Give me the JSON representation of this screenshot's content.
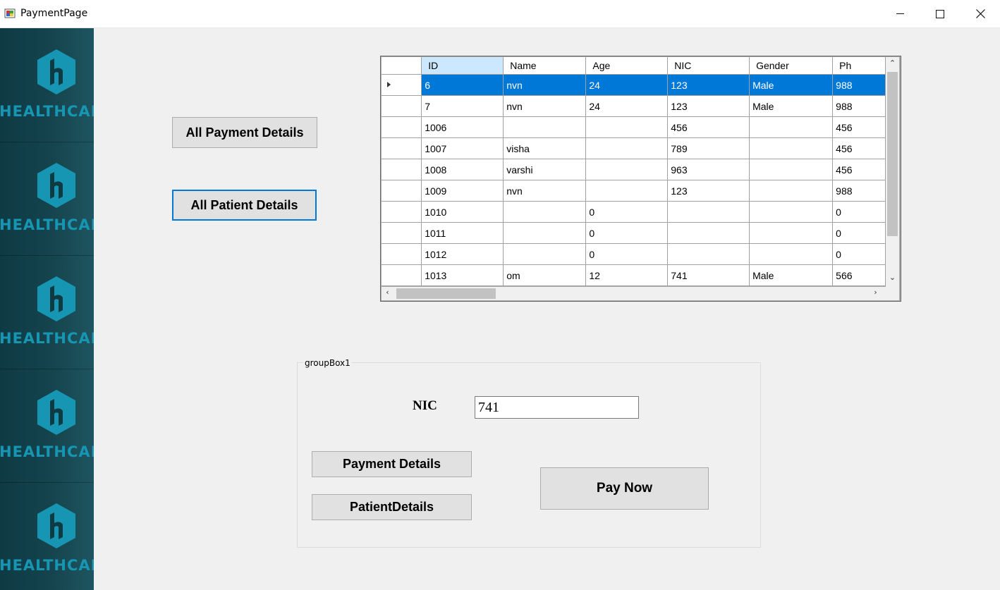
{
  "window": {
    "title": "PaymentPage",
    "minimize_icon": "minimize-icon",
    "maximize_icon": "maximize-icon",
    "close_icon": "close-icon"
  },
  "sidebar": {
    "brand_text": "HEALTHCARE",
    "logo_icon": "healthcare-hexagon-logo",
    "brand_color": "#1796b3",
    "background_color": "#15444e"
  },
  "buttons": {
    "all_payment_details": "All Payment Details",
    "all_patient_details": "All Patient Details",
    "payment_details": "Payment Details",
    "patient_details": "PatientDetails",
    "pay_now": "Pay Now"
  },
  "grid": {
    "columns": [
      "ID",
      "Name",
      "Age",
      "NIC",
      "Gender",
      "Ph"
    ],
    "selected_row": 0,
    "rows": [
      [
        "6",
        "nvn",
        "24",
        "123",
        "Male",
        "988"
      ],
      [
        "7",
        "nvn",
        "24",
        "123",
        "Male",
        "988"
      ],
      [
        "1006",
        "",
        "",
        "456",
        "",
        "456"
      ],
      [
        "1007",
        "visha",
        "",
        "789",
        "",
        "456"
      ],
      [
        "1008",
        "varshi",
        "",
        "963",
        "",
        "456"
      ],
      [
        "1009",
        "nvn",
        "",
        "123",
        "",
        "988"
      ],
      [
        "1010",
        "",
        "0",
        "",
        "",
        "0"
      ],
      [
        "1011",
        "",
        "0",
        "",
        "",
        "0"
      ],
      [
        "1012",
        "",
        "0",
        "",
        "",
        "0"
      ],
      [
        "1013",
        "om",
        "12",
        "741",
        "Male",
        "566"
      ]
    ],
    "selection_color": "#0078d7"
  },
  "groupbox": {
    "title": "groupBox1",
    "nic_label": "NIC",
    "nic_value": "741"
  }
}
